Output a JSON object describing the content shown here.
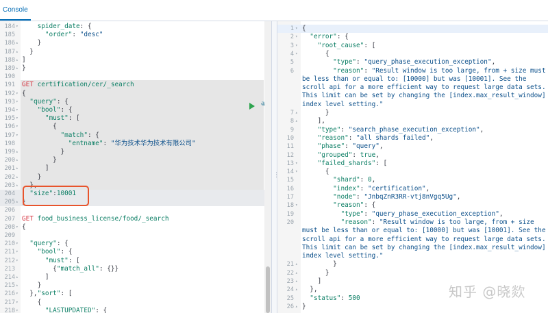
{
  "header": {
    "tab_console": "Console"
  },
  "icons": {
    "play": "play-icon",
    "wrench": "wrench-icon",
    "grip": "grip-icon"
  },
  "watermark": "知乎 @晓欻",
  "left": {
    "lines": [
      {
        "n": "184",
        "f": "▾",
        "t": [
          [
            "    ",
            ""
          ],
          [
            "spider_date",
            "k"
          ],
          [
            ": {",
            ""
          ]
        ]
      },
      {
        "n": "185",
        "f": "",
        "t": [
          [
            "      ",
            ""
          ],
          [
            "\"order\"",
            "k"
          ],
          [
            ": ",
            ""
          ],
          [
            "\"desc\"",
            "s"
          ]
        ]
      },
      {
        "n": "186",
        "f": "▴",
        "t": [
          [
            "    }",
            ""
          ]
        ]
      },
      {
        "n": "187",
        "f": "▴",
        "t": [
          [
            "  }",
            ""
          ]
        ]
      },
      {
        "n": "188",
        "f": "▴",
        "t": [
          [
            "]",
            ""
          ]
        ]
      },
      {
        "n": "189",
        "f": "▴",
        "t": [
          [
            "}",
            ""
          ]
        ]
      },
      {
        "n": "190",
        "f": "",
        "t": [
          [
            "",
            ""
          ]
        ]
      },
      {
        "n": "191",
        "f": "",
        "t": [
          [
            "GET ",
            "m"
          ],
          [
            "certification/cer/_search",
            "u"
          ]
        ]
      },
      {
        "n": "192",
        "f": "▾",
        "t": [
          [
            "{",
            ""
          ]
        ]
      },
      {
        "n": "193",
        "f": "▾",
        "t": [
          [
            "  ",
            ""
          ],
          [
            "\"query\"",
            "k"
          ],
          [
            ": {",
            ""
          ]
        ]
      },
      {
        "n": "194",
        "f": "▾",
        "t": [
          [
            "    ",
            ""
          ],
          [
            "\"bool\"",
            "k"
          ],
          [
            ": {",
            ""
          ]
        ]
      },
      {
        "n": "195",
        "f": "▾",
        "t": [
          [
            "      ",
            ""
          ],
          [
            "\"must\"",
            "k"
          ],
          [
            ": [",
            ""
          ]
        ]
      },
      {
        "n": "196",
        "f": "▾",
        "t": [
          [
            "        {",
            ""
          ]
        ]
      },
      {
        "n": "197",
        "f": "▾",
        "t": [
          [
            "          ",
            ""
          ],
          [
            "\"match\"",
            "k"
          ],
          [
            ": {",
            ""
          ]
        ]
      },
      {
        "n": "198",
        "f": "",
        "t": [
          [
            "            ",
            ""
          ],
          [
            "\"entname\"",
            "k"
          ],
          [
            ": ",
            ""
          ],
          [
            "\"华为技术华为技术有限公司\"",
            "s"
          ]
        ]
      },
      {
        "n": "199",
        "f": "▴",
        "t": [
          [
            "          }",
            ""
          ]
        ]
      },
      {
        "n": "200",
        "f": "▴",
        "t": [
          [
            "        }",
            ""
          ]
        ]
      },
      {
        "n": "201",
        "f": "▴",
        "t": [
          [
            "      ]",
            ""
          ]
        ]
      },
      {
        "n": "202",
        "f": "▴",
        "t": [
          [
            "    }",
            ""
          ]
        ]
      },
      {
        "n": "203",
        "f": "▴",
        "t": [
          [
            "  },",
            ""
          ]
        ]
      },
      {
        "n": "204",
        "f": "",
        "t": [
          [
            "  ",
            ""
          ],
          [
            "\"size\"",
            "k"
          ],
          [
            ":",
            ""
          ],
          [
            "10001",
            "n"
          ]
        ]
      },
      {
        "n": "205",
        "f": "▴",
        "t": [
          [
            "}",
            ""
          ]
        ]
      },
      {
        "n": "206",
        "f": "",
        "t": [
          [
            "",
            ""
          ]
        ]
      },
      {
        "n": "207",
        "f": "",
        "t": [
          [
            "GET ",
            "m"
          ],
          [
            "food_business_license/food/_search",
            "u"
          ]
        ]
      },
      {
        "n": "208",
        "f": "▾",
        "t": [
          [
            "{",
            ""
          ]
        ]
      },
      {
        "n": "209",
        "f": "",
        "t": [
          [
            "",
            ""
          ]
        ]
      },
      {
        "n": "210",
        "f": "▾",
        "t": [
          [
            "  ",
            ""
          ],
          [
            "\"query\"",
            "k"
          ],
          [
            ": {",
            ""
          ]
        ]
      },
      {
        "n": "211",
        "f": "▾",
        "t": [
          [
            "    ",
            ""
          ],
          [
            "\"bool\"",
            "k"
          ],
          [
            ": {",
            ""
          ]
        ]
      },
      {
        "n": "212",
        "f": "▾",
        "t": [
          [
            "      ",
            ""
          ],
          [
            "\"must\"",
            "k"
          ],
          [
            ": [",
            ""
          ]
        ]
      },
      {
        "n": "213",
        "f": "",
        "t": [
          [
            "        {",
            ""
          ],
          [
            "\"match_all\"",
            "k"
          ],
          [
            ": {}}",
            ""
          ]
        ]
      },
      {
        "n": "214",
        "f": "▴",
        "t": [
          [
            "      ]",
            ""
          ]
        ]
      },
      {
        "n": "215",
        "f": "▴",
        "t": [
          [
            "    }",
            ""
          ]
        ]
      },
      {
        "n": "216",
        "f": "▾",
        "t": [
          [
            "  },",
            ""
          ],
          [
            "\"sort\"",
            "k"
          ],
          [
            ": [",
            ""
          ]
        ]
      },
      {
        "n": "217",
        "f": "▾",
        "t": [
          [
            "    {",
            ""
          ]
        ]
      },
      {
        "n": "218",
        "f": "▾",
        "t": [
          [
            "      ",
            ""
          ],
          [
            "\"LASTUPDATED\"",
            "k"
          ],
          [
            ": {",
            ""
          ]
        ]
      }
    ]
  },
  "right": {
    "lines": [
      {
        "n": "1",
        "f": "▾",
        "t": [
          [
            "{",
            ""
          ]
        ]
      },
      {
        "n": "2",
        "f": "▾",
        "t": [
          [
            "  ",
            ""
          ],
          [
            "\"error\"",
            "k"
          ],
          [
            ": {",
            ""
          ]
        ]
      },
      {
        "n": "3",
        "f": "▾",
        "t": [
          [
            "    ",
            ""
          ],
          [
            "\"root_cause\"",
            "k"
          ],
          [
            ": [",
            ""
          ]
        ]
      },
      {
        "n": "4",
        "f": "▾",
        "t": [
          [
            "      {",
            ""
          ]
        ]
      },
      {
        "n": "5",
        "f": "",
        "t": [
          [
            "        ",
            ""
          ],
          [
            "\"type\"",
            "k"
          ],
          [
            ": ",
            ""
          ],
          [
            "\"query_phase_execution_exception\"",
            "s"
          ],
          [
            ",",
            ""
          ]
        ]
      },
      {
        "n": "6",
        "f": "",
        "t": [
          [
            "        ",
            ""
          ],
          [
            "\"reason\"",
            "k"
          ],
          [
            ": ",
            ""
          ],
          [
            "\"Result window is too large, from + size must",
            "s"
          ]
        ]
      },
      {
        "n": "",
        "f": "",
        "w": true,
        "t": [
          [
            "be less than or equal to: [10000] but was [10001]. See the",
            "s"
          ]
        ]
      },
      {
        "n": "",
        "f": "",
        "w": true,
        "t": [
          [
            "scroll api for a more efficient way to request large data sets.",
            "s"
          ]
        ]
      },
      {
        "n": "",
        "f": "",
        "w": true,
        "t": [
          [
            "This limit can be set by changing the [index.max_result_window]",
            "s"
          ]
        ]
      },
      {
        "n": "",
        "f": "",
        "w": true,
        "t": [
          [
            "index level setting.\"",
            "s"
          ]
        ]
      },
      {
        "n": "7",
        "f": "▴",
        "t": [
          [
            "      }",
            ""
          ]
        ]
      },
      {
        "n": "8",
        "f": "▴",
        "t": [
          [
            "    ],",
            ""
          ]
        ]
      },
      {
        "n": "9",
        "f": "",
        "t": [
          [
            "    ",
            ""
          ],
          [
            "\"type\"",
            "k"
          ],
          [
            ": ",
            ""
          ],
          [
            "\"search_phase_execution_exception\"",
            "s"
          ],
          [
            ",",
            ""
          ]
        ]
      },
      {
        "n": "10",
        "f": "",
        "t": [
          [
            "    ",
            ""
          ],
          [
            "\"reason\"",
            "k"
          ],
          [
            ": ",
            ""
          ],
          [
            "\"all shards failed\"",
            "s"
          ],
          [
            ",",
            ""
          ]
        ]
      },
      {
        "n": "11",
        "f": "",
        "t": [
          [
            "    ",
            ""
          ],
          [
            "\"phase\"",
            "k"
          ],
          [
            ": ",
            ""
          ],
          [
            "\"query\"",
            "s"
          ],
          [
            ",",
            ""
          ]
        ]
      },
      {
        "n": "12",
        "f": "",
        "t": [
          [
            "    ",
            ""
          ],
          [
            "\"grouped\"",
            "k"
          ],
          [
            ": ",
            ""
          ],
          [
            "true",
            "n"
          ],
          [
            ",",
            ""
          ]
        ]
      },
      {
        "n": "13",
        "f": "▾",
        "t": [
          [
            "    ",
            ""
          ],
          [
            "\"failed_shards\"",
            "k"
          ],
          [
            ": [",
            ""
          ]
        ]
      },
      {
        "n": "14",
        "f": "▾",
        "t": [
          [
            "      {",
            ""
          ]
        ]
      },
      {
        "n": "15",
        "f": "",
        "t": [
          [
            "        ",
            ""
          ],
          [
            "\"shard\"",
            "k"
          ],
          [
            ": ",
            ""
          ],
          [
            "0",
            "n"
          ],
          [
            ",",
            ""
          ]
        ]
      },
      {
        "n": "16",
        "f": "",
        "t": [
          [
            "        ",
            ""
          ],
          [
            "\"index\"",
            "k"
          ],
          [
            ": ",
            ""
          ],
          [
            "\"certification\"",
            "s"
          ],
          [
            ",",
            ""
          ]
        ]
      },
      {
        "n": "17",
        "f": "",
        "t": [
          [
            "        ",
            ""
          ],
          [
            "\"node\"",
            "k"
          ],
          [
            ": ",
            ""
          ],
          [
            "\"JnbqZnR3RR-vtj8nVgq5Ug\"",
            "s"
          ],
          [
            ",",
            ""
          ]
        ]
      },
      {
        "n": "18",
        "f": "▾",
        "t": [
          [
            "        ",
            ""
          ],
          [
            "\"reason\"",
            "k"
          ],
          [
            ": {",
            ""
          ]
        ]
      },
      {
        "n": "19",
        "f": "",
        "t": [
          [
            "          ",
            ""
          ],
          [
            "\"type\"",
            "k"
          ],
          [
            ": ",
            ""
          ],
          [
            "\"query_phase_execution_exception\"",
            "s"
          ],
          [
            ",",
            ""
          ]
        ]
      },
      {
        "n": "20",
        "f": "",
        "t": [
          [
            "          ",
            ""
          ],
          [
            "\"reason\"",
            "k"
          ],
          [
            ": ",
            ""
          ],
          [
            "\"Result window is too large, from + size",
            "s"
          ]
        ]
      },
      {
        "n": "",
        "f": "",
        "w": true,
        "t": [
          [
            "must be less than or equal to: [10000] but was [10001]. See the",
            "s"
          ]
        ]
      },
      {
        "n": "",
        "f": "",
        "w": true,
        "t": [
          [
            "scroll api for a more efficient way to request large data sets.",
            "s"
          ]
        ]
      },
      {
        "n": "",
        "f": "",
        "w": true,
        "t": [
          [
            "This limit can be set by changing the [index.max_result_window]",
            "s"
          ]
        ]
      },
      {
        "n": "",
        "f": "",
        "w": true,
        "t": [
          [
            "index level setting.\"",
            "s"
          ]
        ]
      },
      {
        "n": "21",
        "f": "▴",
        "t": [
          [
            "        }",
            ""
          ]
        ]
      },
      {
        "n": "22",
        "f": "▴",
        "t": [
          [
            "      }",
            ""
          ]
        ]
      },
      {
        "n": "23",
        "f": "▴",
        "t": [
          [
            "    ]",
            ""
          ]
        ]
      },
      {
        "n": "24",
        "f": "▴",
        "t": [
          [
            "  },",
            ""
          ]
        ]
      },
      {
        "n": "25",
        "f": "",
        "t": [
          [
            "  ",
            ""
          ],
          [
            "\"status\"",
            "k"
          ],
          [
            ": ",
            ""
          ],
          [
            "500",
            "n"
          ]
        ]
      },
      {
        "n": "26",
        "f": "▴",
        "t": [
          [
            "}",
            ""
          ]
        ]
      }
    ]
  }
}
